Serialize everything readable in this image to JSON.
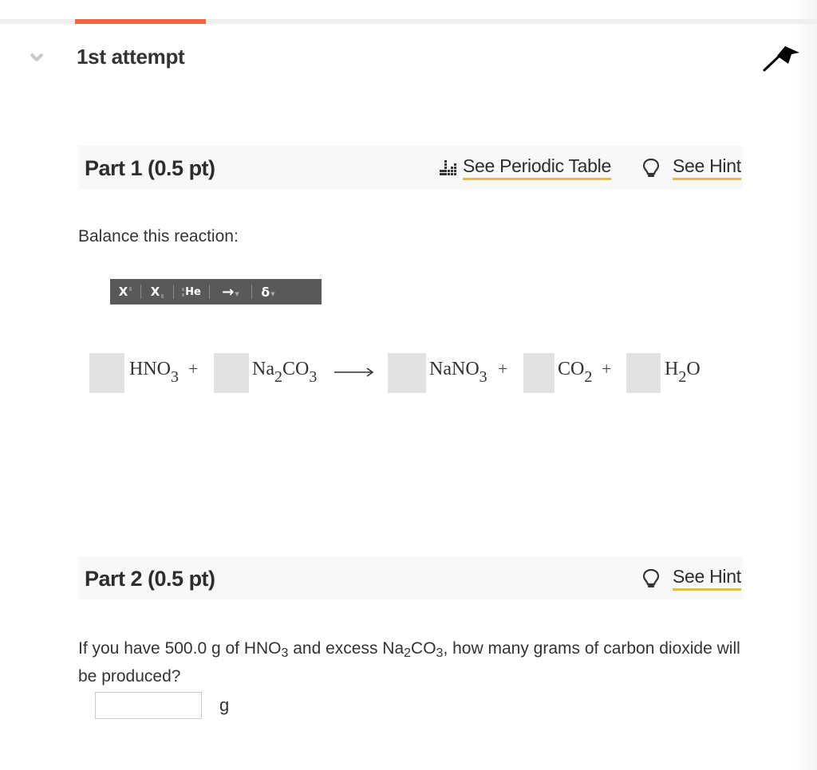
{
  "attempt": {
    "title": "1st attempt",
    "progress_fraction": 0.16,
    "icons": {
      "collapse": "chevron-down-icon",
      "flag": "flag-icon"
    }
  },
  "part1": {
    "title": "Part 1 (0.5 pt)",
    "periodic_table_link": "See Periodic Table",
    "hint_link": "See Hint",
    "prompt": "Balance this reaction:",
    "toolbar": {
      "superscript": "X",
      "subscript": "X",
      "isotope": "He",
      "arrow": "→",
      "delta": "δ"
    },
    "equation": {
      "reactants": [
        {
          "formula_main": "HNO",
          "sub": "3",
          "suffix": "",
          "suffix_sub": "",
          "coefficient": ""
        },
        {
          "formula_main": "Na",
          "sub": "2",
          "suffix": "CO",
          "suffix_sub": "3",
          "coefficient": ""
        }
      ],
      "products": [
        {
          "formula_main": "NaNO",
          "sub": "3",
          "suffix": "",
          "suffix_sub": "",
          "coefficient": ""
        },
        {
          "formula_main": "CO",
          "sub": "2",
          "suffix": "",
          "suffix_sub": "",
          "coefficient": ""
        },
        {
          "formula_main": "H",
          "sub": "2",
          "suffix": "O",
          "suffix_sub": "",
          "coefficient": ""
        }
      ],
      "plus": "+",
      "arrow": "⟶"
    }
  },
  "part2": {
    "title": "Part 2 (0.5 pt)",
    "hint_link": "See Hint",
    "question": {
      "t1": "If you have 500.0 g of HNO",
      "s1": "3",
      "t2": " and excess Na",
      "s2": "2",
      "t3": "CO",
      "s3": "3",
      "t4": ", how many grams of carbon dioxide will be produced?"
    },
    "answer_value": "",
    "unit": "g"
  }
}
